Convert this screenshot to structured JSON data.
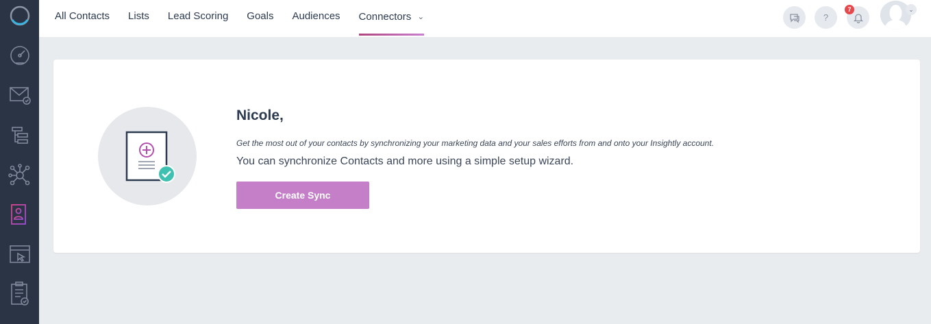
{
  "sidebar": {
    "items": [
      {
        "icon": "logo-ring-icon"
      },
      {
        "icon": "dashboard-gauge-icon"
      },
      {
        "icon": "email-icon"
      },
      {
        "icon": "automation-flow-icon"
      },
      {
        "icon": "network-hub-icon"
      },
      {
        "icon": "contacts-icon",
        "active": true
      },
      {
        "icon": "landing-page-icon"
      },
      {
        "icon": "clipboard-check-icon"
      }
    ]
  },
  "nav": {
    "items": [
      {
        "label": "All Contacts"
      },
      {
        "label": "Lists"
      },
      {
        "label": "Lead Scoring"
      },
      {
        "label": "Goals"
      },
      {
        "label": "Audiences"
      },
      {
        "label": "Connectors",
        "active": true
      }
    ]
  },
  "topbar": {
    "help_label": "?",
    "notification_count": "7"
  },
  "main": {
    "greeting": "Nicole,",
    "subtitle": "Get the most out of your contacts by synchronizing your marketing data and your sales efforts from and onto your Insightly account.",
    "description": "You can synchronize Contacts and more using a simple setup wizard.",
    "button_label": "Create Sync"
  },
  "colors": {
    "sidebar_bg": "#2b3445",
    "accent": "#c47fc8",
    "check_teal": "#3ec1b0"
  }
}
